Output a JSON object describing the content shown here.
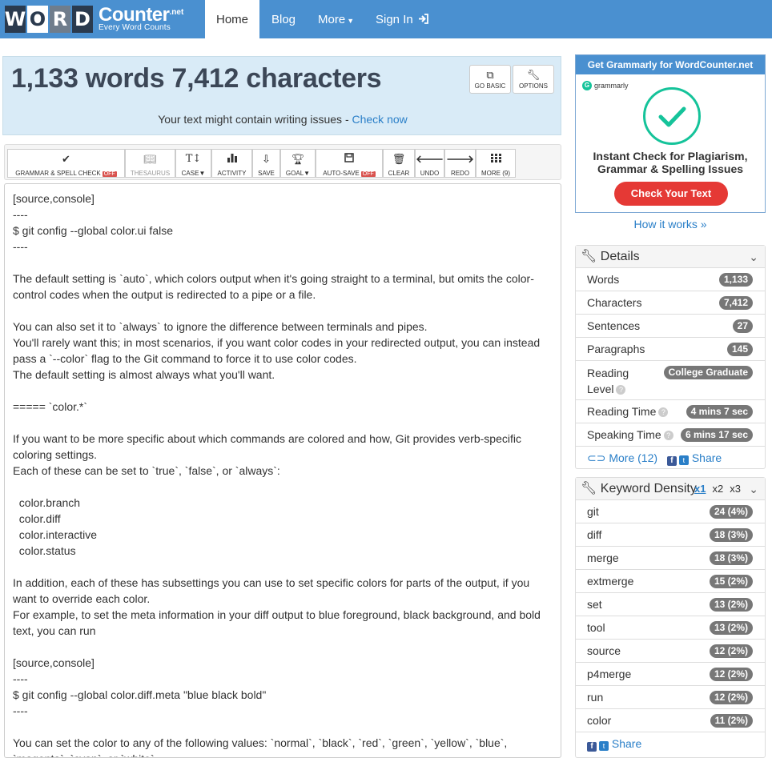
{
  "logo": {
    "letters": [
      "W",
      "O",
      "R",
      "D"
    ],
    "name": "Counter",
    "tld": ".net",
    "tagline": "Every Word Counts"
  },
  "nav": {
    "home": "Home",
    "blog": "Blog",
    "more": "More",
    "sign_in": "Sign In"
  },
  "counter": {
    "title": "1,133 words 7,412 characters",
    "go_basic": "GO BASIC",
    "options": "OPTIONS",
    "issue_text": "Your text might contain writing issues - ",
    "issue_link": "Check now"
  },
  "toolbar": {
    "grammar": "GRAMMAR & SPELL CHECK",
    "off": "OFF",
    "thesaurus": "THESAURUS",
    "case": "CASE",
    "activity": "ACTIVITY",
    "save": "SAVE",
    "goal": "GOAL",
    "autosave": "AUTO-SAVE",
    "clear": "CLEAR",
    "undo": "UNDO",
    "redo": "REDO",
    "more": "MORE (9)"
  },
  "editor_text": "[source,console]\n----\n$ git config --global color.ui false\n----\n\nThe default setting is `auto`, which colors output when it's going straight to a terminal, but omits the color-control codes when the output is redirected to a pipe or a file.\n\nYou can also set it to `always` to ignore the difference between terminals and pipes.\nYou'll rarely want this; in most scenarios, if you want color codes in your redirected output, you can instead pass a `--color` flag to the Git command to force it to use color codes.\nThe default setting is almost always what you'll want.\n\n===== `color.*`\n\nIf you want to be more specific about which commands are colored and how, Git provides verb-specific coloring settings.\nEach of these can be set to `true`, `false`, or `always`:\n\n  color.branch\n  color.diff\n  color.interactive\n  color.status\n\nIn addition, each of these has subsettings you can use to set specific colors for parts of the output, if you want to override each color.\nFor example, to set the meta information in your diff output to blue foreground, black background, and bold text, you can run\n\n[source,console]\n----\n$ git config --global color.diff.meta \"blue black bold\"\n----\n\nYou can set the color to any of the following values: `normal`, `black`, `red`, `green`, `yellow`, `blue`, `magenta`, `cyan`, or `white`.",
  "ad": {
    "header": "Get Grammarly for WordCounter.net",
    "brand": "grammarly",
    "headline_1": "Instant Check for Plagiarism,",
    "headline_2": "Grammar & Spelling Issues",
    "button": "Check Your Text",
    "how": "How it works »"
  },
  "details": {
    "title": "Details",
    "words_label": "Words",
    "words": "1,133",
    "chars_label": "Characters",
    "chars": "7,412",
    "sentences_label": "Sentences",
    "sentences": "27",
    "paragraphs_label": "Paragraphs",
    "paragraphs": "145",
    "reading_level_label_1": "Reading",
    "reading_level_label_2": "Level",
    "reading_level": "College Graduate",
    "reading_time_label": "Reading Time",
    "reading_time": "4 mins 7 sec",
    "speaking_time_label": "Speaking Time",
    "speaking_time": "6 mins 17 sec",
    "more": "More (12)",
    "share": "Share"
  },
  "keywords": {
    "title": "Keyword Density",
    "tabs": [
      "x1",
      "x2",
      "x3"
    ],
    "items": [
      {
        "word": "git",
        "count": "24 (4%)"
      },
      {
        "word": "diff",
        "count": "18 (3%)"
      },
      {
        "word": "merge",
        "count": "18 (3%)"
      },
      {
        "word": "extmerge",
        "count": "15 (2%)"
      },
      {
        "word": "set",
        "count": "13 (2%)"
      },
      {
        "word": "tool",
        "count": "13 (2%)"
      },
      {
        "word": "source",
        "count": "12 (2%)"
      },
      {
        "word": "p4merge",
        "count": "12 (2%)"
      },
      {
        "word": "run",
        "count": "12 (2%)"
      },
      {
        "word": "color",
        "count": "11 (2%)"
      }
    ],
    "share": "Share"
  }
}
